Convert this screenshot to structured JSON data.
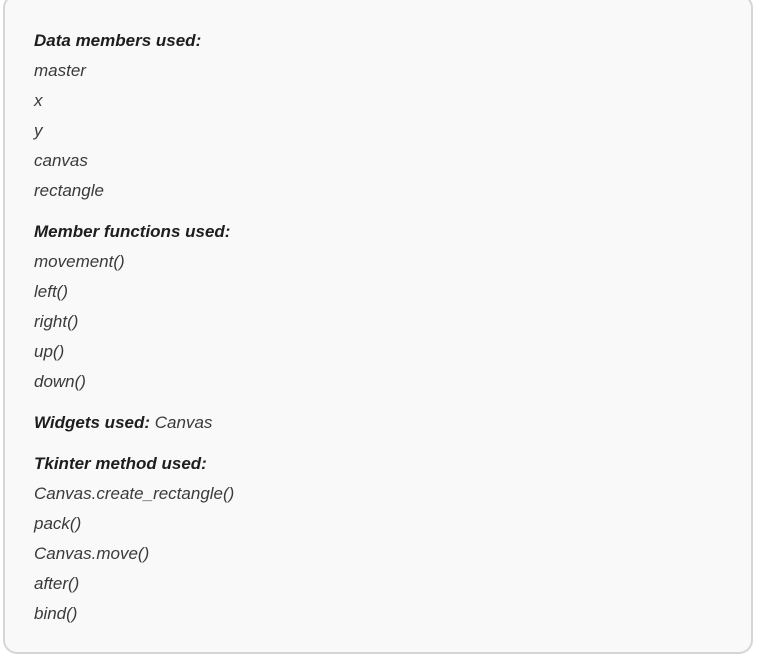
{
  "sections": {
    "data_members": {
      "heading": "Data members used:",
      "items": [
        "master",
        "x",
        "y",
        "canvas",
        "rectangle"
      ]
    },
    "member_functions": {
      "heading": "Member functions used:",
      "items": [
        "movement()",
        "left()",
        "right()",
        "up()",
        "down()"
      ]
    },
    "widgets": {
      "heading": "Widgets used:",
      "value": "Canvas"
    },
    "tkinter_methods": {
      "heading": "Tkinter method used:",
      "items": [
        "Canvas.create_rectangle()",
        "pack()",
        "Canvas.move()",
        "after()",
        "bind()"
      ]
    }
  }
}
